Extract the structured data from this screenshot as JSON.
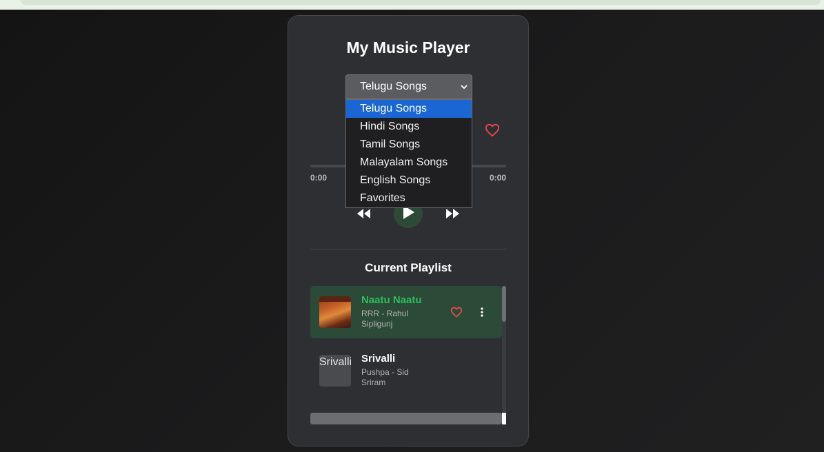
{
  "app": {
    "title": "My Music Player"
  },
  "category_select": {
    "selected": "Telugu Songs",
    "options": [
      "Telugu Songs",
      "Hindi Songs",
      "Tamil Songs",
      "Malayalam Songs",
      "English Songs",
      "Favorites"
    ]
  },
  "player": {
    "current_time": "0:00",
    "duration": "0:00",
    "progress": 0
  },
  "playlist": {
    "title": "Current Playlist",
    "songs": [
      {
        "name": "Naatu Naatu",
        "artist": "RRR - Rahul Sipligunj",
        "active": true
      },
      {
        "name": "Srivalli",
        "artist": "Pushpa - Sid Sriram",
        "thumb_alt": "Srivalli",
        "active": false
      }
    ]
  },
  "colors": {
    "accent": "#2ebd5d",
    "heart": "#e94b4b",
    "background": "#1b1b1c",
    "card": "#2e2f33",
    "dropdown_highlight": "#1a66d2"
  },
  "icons": {
    "select": "chevron-down-icon",
    "favorite": "heart-icon",
    "previous": "rewind-icon",
    "play": "play-icon",
    "next": "fast-forward-icon",
    "menu": "more-vertical-icon"
  }
}
